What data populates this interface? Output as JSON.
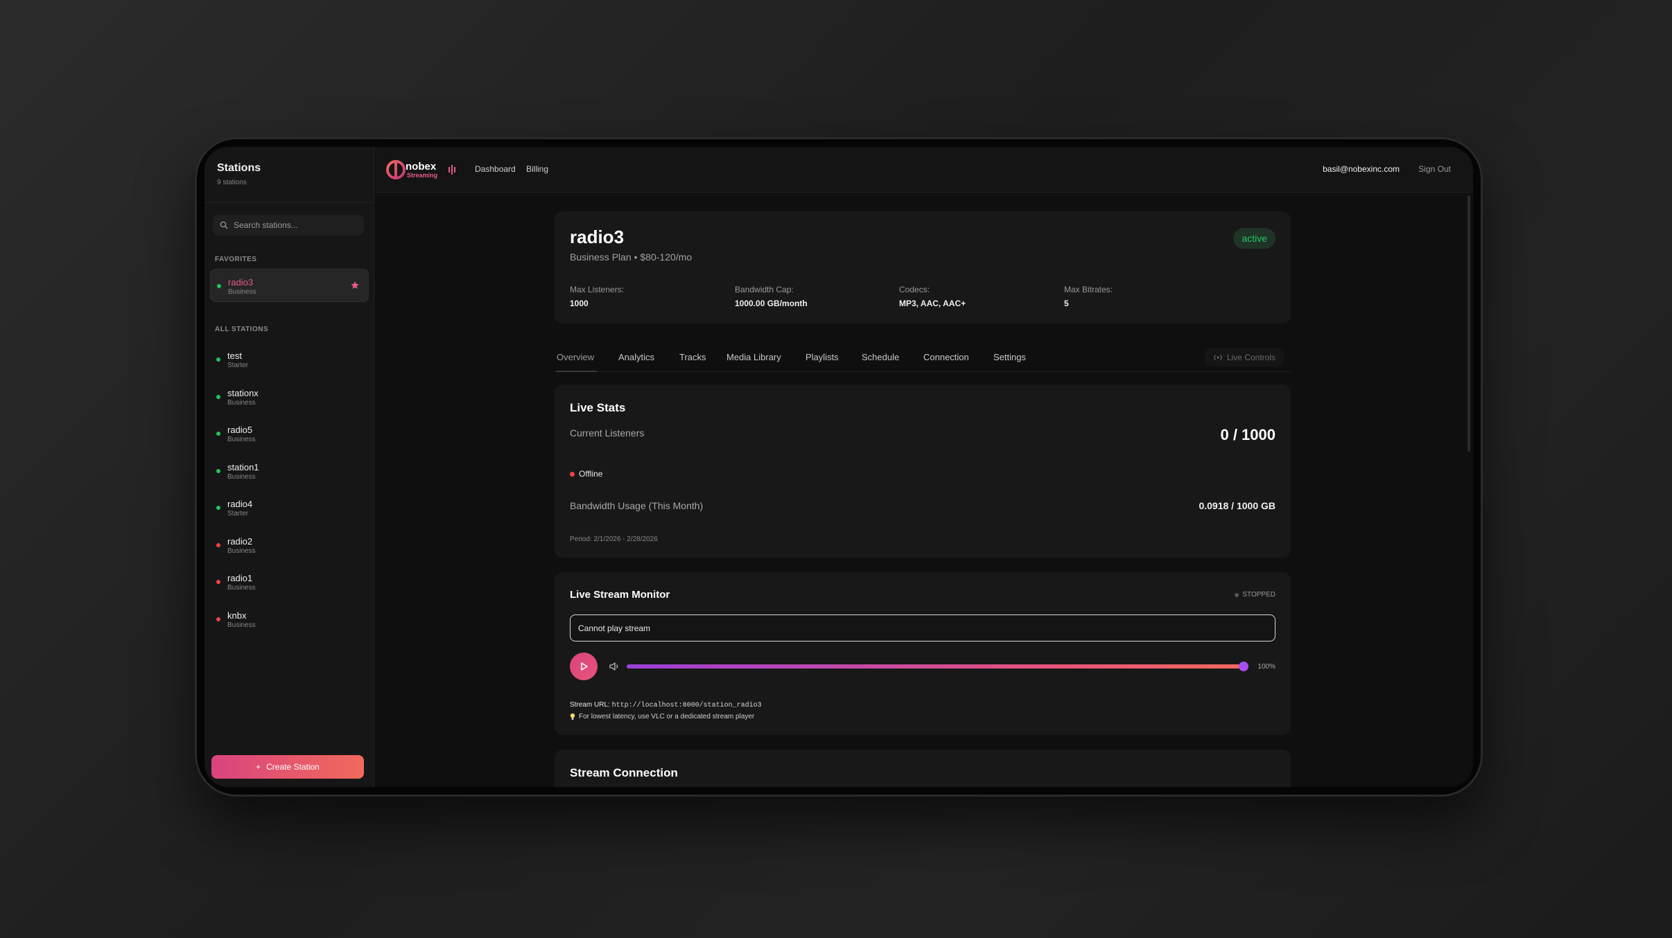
{
  "sidebar": {
    "title": "Stations",
    "count": "9 stations",
    "search_placeholder": "Search stations...",
    "favorites_label": "FAVORITES",
    "all_label": "ALL STATIONS",
    "favorites": [
      {
        "name": "radio3",
        "plan": "Business",
        "status": "online"
      }
    ],
    "stations": [
      {
        "name": "test",
        "plan": "Starter",
        "status": "online"
      },
      {
        "name": "stationx",
        "plan": "Business",
        "status": "online"
      },
      {
        "name": "radio5",
        "plan": "Business",
        "status": "online"
      },
      {
        "name": "station1",
        "plan": "Business",
        "status": "online"
      },
      {
        "name": "radio4",
        "plan": "Starter",
        "status": "online"
      },
      {
        "name": "radio2",
        "plan": "Business",
        "status": "offline"
      },
      {
        "name": "radio1",
        "plan": "Business",
        "status": "offline"
      },
      {
        "name": "knbx",
        "plan": "Business",
        "status": "offline"
      }
    ],
    "create_label": "Create Station"
  },
  "topbar": {
    "logo_text": "nobex",
    "logo_sub": "Streaming",
    "nav": [
      "Dashboard",
      "Billing"
    ],
    "email": "basil@nobexinc.com",
    "signout": "Sign Out"
  },
  "station": {
    "name": "radio3",
    "plan_line": "Business Plan • $80-120/mo",
    "status": "active",
    "specs": [
      {
        "label": "Max Listeners:",
        "value": "1000"
      },
      {
        "label": "Bandwidth Cap:",
        "value": "1000.00 GB/month"
      },
      {
        "label": "Codecs:",
        "value": "MP3, AAC, AAC+"
      },
      {
        "label": "Max Bitrates:",
        "value": "5"
      }
    ]
  },
  "tabs": [
    "Overview",
    "Analytics",
    "Tracks",
    "Media Library",
    "Playlists",
    "Schedule",
    "Connection",
    "Settings"
  ],
  "live_controls": "Live Controls",
  "live_stats": {
    "title": "Live Stats",
    "listeners_label": "Current Listeners",
    "listeners_value": "0 / 1000",
    "status": "Offline",
    "bandwidth_label": "Bandwidth Usage (This Month)",
    "bandwidth_value": "0.0918 / 1000 GB",
    "period": "Period: 2/1/2026 - 2/28/2026"
  },
  "monitor": {
    "title": "Live Stream Monitor",
    "state": "STOPPED",
    "message": "Cannot play stream",
    "volume_percent": 100,
    "volume_label": "100%",
    "url_label": "Stream URL:",
    "url": "http://localhost:8000/station_radio3",
    "tip": "For lowest latency, use VLC or a dedicated stream player"
  },
  "connection": {
    "title": "Stream Connection"
  },
  "colors": {
    "accent_start": "#d9447e",
    "accent_end": "#f06a5c",
    "online": "#22c55e",
    "offline": "#ef4444",
    "active_badge": "#27c864"
  }
}
